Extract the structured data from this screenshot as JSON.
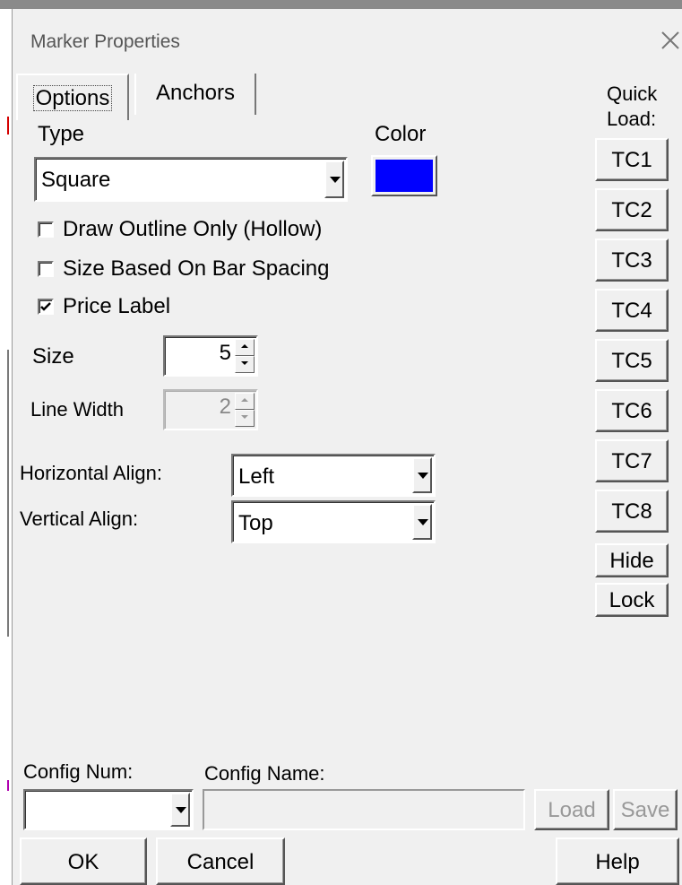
{
  "window": {
    "title": "Marker Properties"
  },
  "tabs": [
    {
      "label": "Options"
    },
    {
      "label": "Anchors"
    }
  ],
  "type": {
    "label": "Type",
    "value": "Square"
  },
  "color": {
    "label": "Color",
    "value": "#0000ff"
  },
  "checkboxes": [
    {
      "label": "Draw Outline Only (Hollow)",
      "checked": false
    },
    {
      "label": "Size Based On Bar Spacing",
      "checked": false
    },
    {
      "label": "Price Label",
      "checked": true
    }
  ],
  "size": {
    "label": "Size",
    "value": "5"
  },
  "line_width": {
    "label": "Line Width",
    "value": "2"
  },
  "horizontal_align": {
    "label": "Horizontal Align:",
    "value": "Left"
  },
  "vertical_align": {
    "label": "Vertical Align:",
    "value": "Top"
  },
  "quick_load": {
    "label_line1": "Quick",
    "label_line2": "Load:",
    "buttons": [
      "TC1",
      "TC2",
      "TC3",
      "TC4",
      "TC5",
      "TC6",
      "TC7",
      "TC8"
    ],
    "hide": "Hide",
    "lock": "Lock"
  },
  "config": {
    "num_label": "Config Num:",
    "name_label": "Config Name:",
    "num_value": "",
    "name_value": "",
    "load": "Load",
    "save": "Save"
  },
  "footer": {
    "ok": "OK",
    "cancel": "Cancel",
    "help": "Help"
  }
}
